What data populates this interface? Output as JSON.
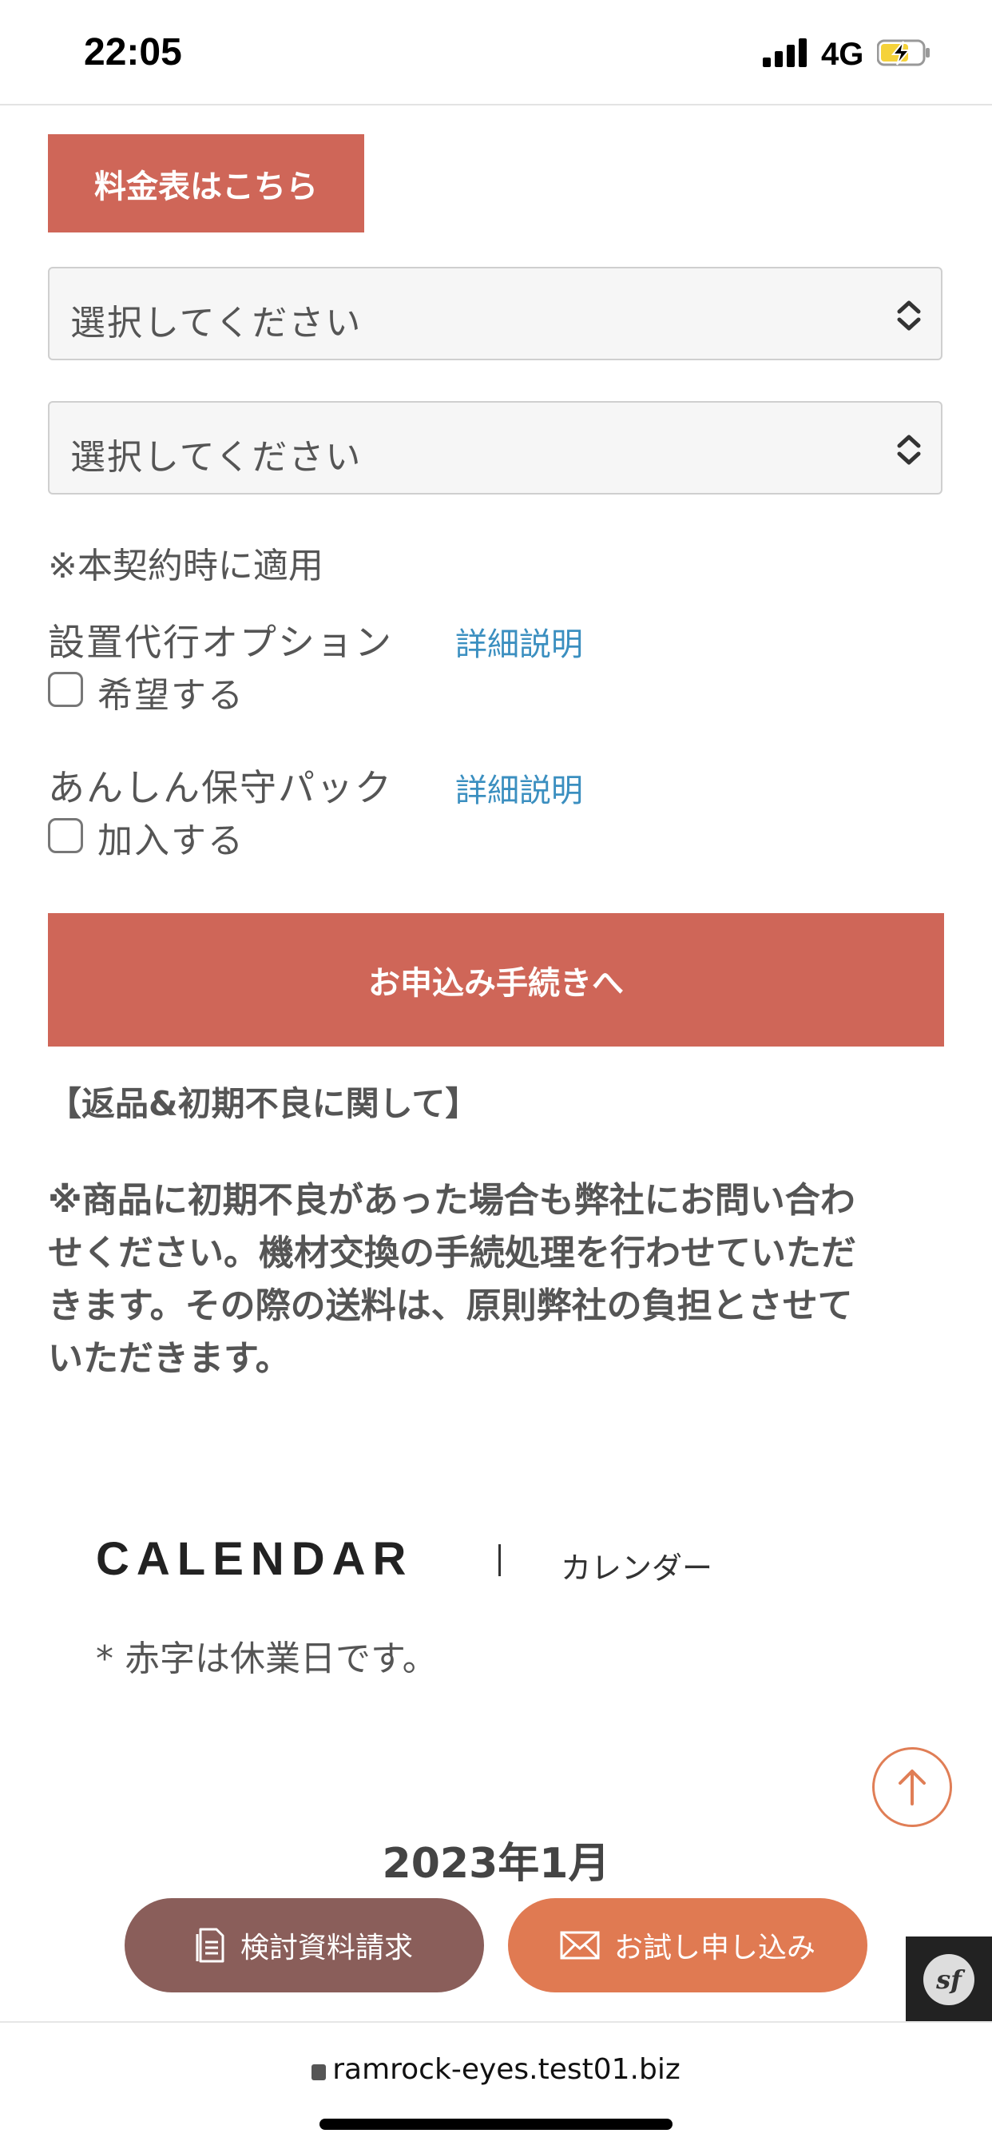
{
  "status_bar": {
    "time": "22:05",
    "network": "4G"
  },
  "price_table_button": "料金表はこちら",
  "selects": [
    {
      "value": "選択してください"
    },
    {
      "value": "選択してください"
    }
  ],
  "note": "※本契約時に適用",
  "options": [
    {
      "label": "設置代行オプション",
      "link": "詳細説明",
      "checkbox_label": "希望する"
    },
    {
      "label": "あんしん保守パック",
      "link": "詳細説明",
      "checkbox_label": "加入する"
    }
  ],
  "apply_button": "お申込み手続きへ",
  "returns": {
    "title": "【返品&初期不良に関して】",
    "text_lines": [
      "※商品に初期不良があった場合も弊社にお問い合わ",
      "せください。機材交換の手続処理を行わせていただ",
      "きます。その際の送料は、原則弊社の負担とさせて",
      "いただきます。"
    ]
  },
  "calendar": {
    "title": "CALENDAR",
    "subtitle": "カレンダー",
    "note": "* 赤字は休業日です。",
    "month": "2023年1月"
  },
  "bottom_bar": {
    "doc_request": "検討資料請求",
    "trial": "お試し申し込み"
  },
  "browser": {
    "url": "ramrock-eyes.test01.biz"
  },
  "colors": {
    "accent_red": "#cf6658",
    "orange": "#e07a52",
    "brown": "#8a5e5a",
    "link_blue": "#3b8fc0"
  }
}
